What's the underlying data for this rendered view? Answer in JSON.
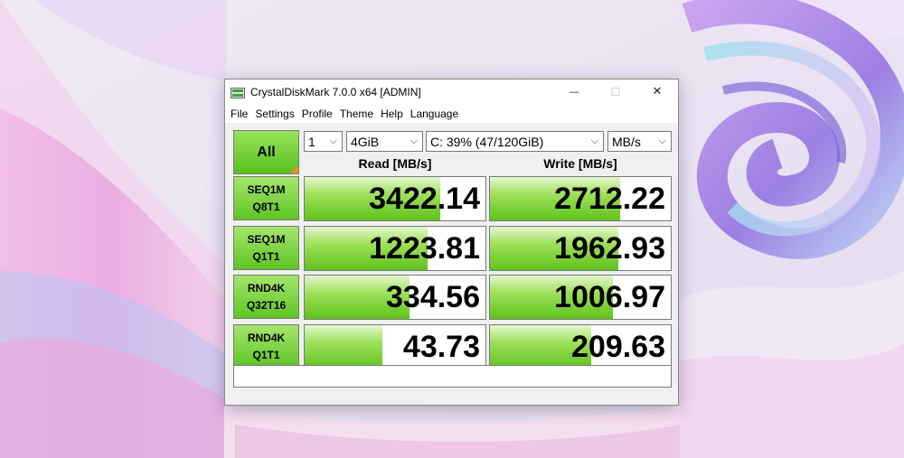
{
  "window": {
    "title": "CrystalDiskMark 7.0.0 x64 [ADMIN]",
    "minimize_glyph": "—",
    "maximize_glyph": "☐",
    "close_glyph": "✕"
  },
  "menu": [
    "File",
    "Settings",
    "Profile",
    "Theme",
    "Help",
    "Language"
  ],
  "controls": {
    "all_label": "All",
    "count": "1",
    "size": "4GiB",
    "drive": "C: 39% (47/120GiB)",
    "unit": "MB/s"
  },
  "headers": {
    "read": "Read [MB/s]",
    "write": "Write [MB/s]"
  },
  "tests": [
    {
      "line1": "SEQ1M",
      "line2": "Q8T1",
      "read": "3422.14",
      "read_bar": 0.75,
      "write": "2712.22",
      "write_bar": 0.72
    },
    {
      "line1": "SEQ1M",
      "line2": "Q1T1",
      "read": "1223.81",
      "read_bar": 0.68,
      "write": "1962.93",
      "write_bar": 0.71
    },
    {
      "line1": "RND4K",
      "line2": "Q32T16",
      "read": "334.56",
      "read_bar": 0.58,
      "write": "1006.97",
      "write_bar": 0.68
    },
    {
      "line1": "RND4K",
      "line2": "Q1T1",
      "read": "43.73",
      "read_bar": 0.43,
      "write": "209.63",
      "write_bar": 0.56
    }
  ],
  "comment": "",
  "colors": {
    "accent_green": "#5ec31c",
    "corner_orange": "#f08a1c"
  }
}
